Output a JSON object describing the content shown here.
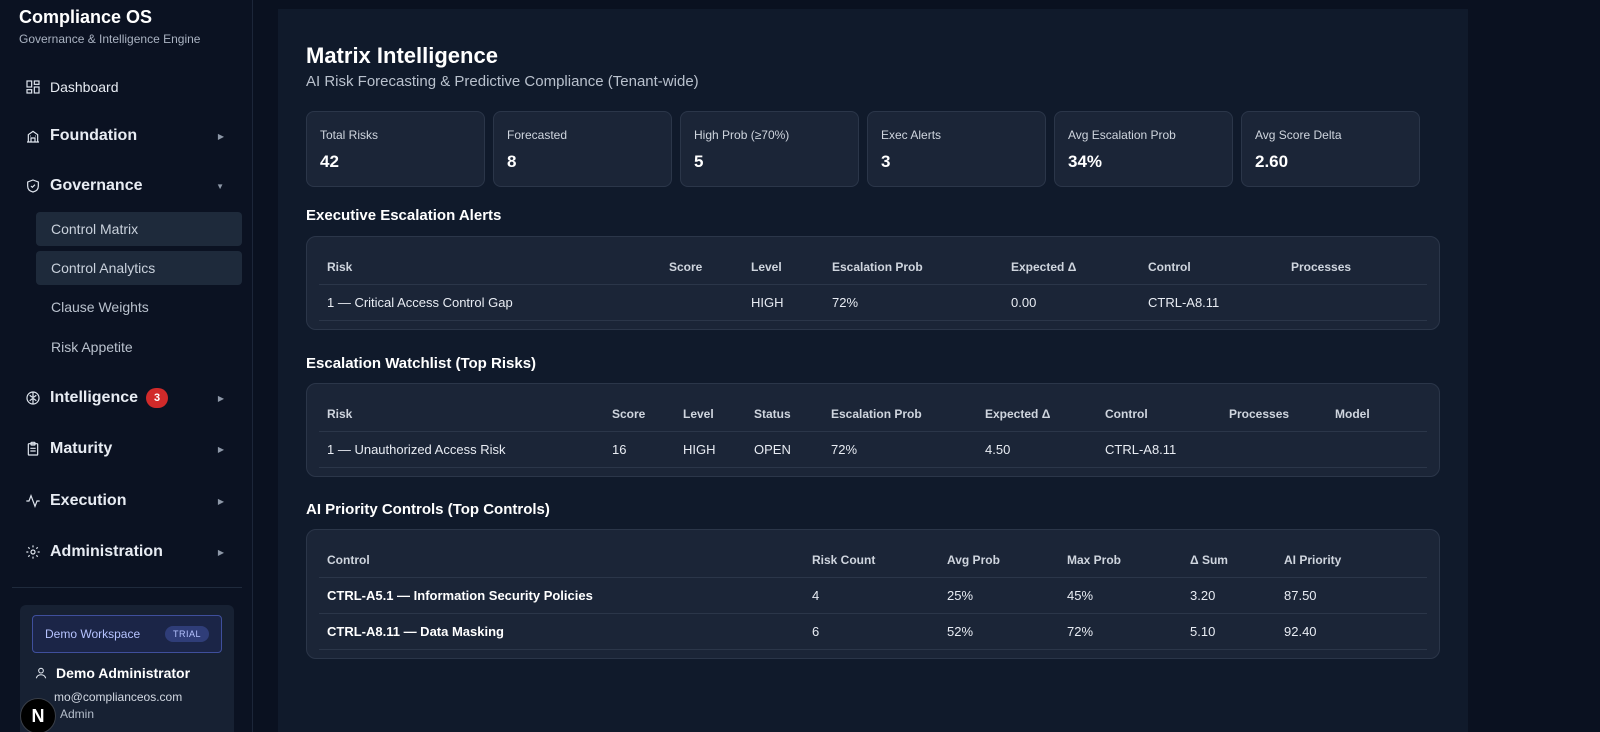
{
  "app": {
    "title": "Compliance OS",
    "subtitle": "Governance & Intelligence Engine"
  },
  "sidebar": {
    "dashboard": "Dashboard",
    "sections": [
      {
        "label": "Foundation"
      },
      {
        "label": "Governance"
      },
      {
        "label": "Intelligence",
        "badge": "3"
      },
      {
        "label": "Maturity"
      },
      {
        "label": "Execution"
      },
      {
        "label": "Administration"
      }
    ],
    "governance_items": [
      "Control Matrix",
      "Control Analytics",
      "Clause Weights",
      "Risk Appetite"
    ]
  },
  "user": {
    "workspace": "Demo Workspace",
    "plan": "TRIAL",
    "name": "Demo Administrator",
    "email": "mo@complianceos.com",
    "role": "Admin"
  },
  "page": {
    "title": "Matrix Intelligence",
    "subtitle": "AI Risk Forecasting & Predictive Compliance (Tenant-wide)"
  },
  "stats": [
    {
      "label": "Total Risks",
      "value": "42"
    },
    {
      "label": "Forecasted",
      "value": "8"
    },
    {
      "label": "High Prob (≥70%)",
      "value": "5"
    },
    {
      "label": "Exec Alerts",
      "value": "3"
    },
    {
      "label": "Avg Escalation Prob",
      "value": "34%"
    },
    {
      "label": "Avg Score Delta",
      "value": "2.60"
    }
  ],
  "exec_alerts": {
    "title": "Executive Escalation Alerts",
    "headers": [
      "Risk",
      "Score",
      "Level",
      "Escalation Prob",
      "Expected Δ",
      "Control",
      "Processes"
    ],
    "rows": [
      [
        "1 — Critical Access Control Gap",
        "",
        "HIGH",
        "72%",
        "0.00",
        "CTRL-A8.11",
        ""
      ]
    ]
  },
  "watchlist": {
    "title": "Escalation Watchlist (Top Risks)",
    "headers": [
      "Risk",
      "Score",
      "Level",
      "Status",
      "Escalation Prob",
      "Expected Δ",
      "Control",
      "Processes",
      "Model"
    ],
    "rows": [
      [
        "1 — Unauthorized Access Risk",
        "16",
        "HIGH",
        "OPEN",
        "72%",
        "4.50",
        "CTRL-A8.11",
        "",
        ""
      ]
    ]
  },
  "priority": {
    "title": "AI Priority Controls (Top Controls)",
    "headers": [
      "Control",
      "Risk Count",
      "Avg Prob",
      "Max Prob",
      "Δ Sum",
      "AI Priority"
    ],
    "rows": [
      [
        "CTRL-A5.1 — Information Security Policies",
        "4",
        "25%",
        "45%",
        "3.20",
        "87.50"
      ],
      [
        "CTRL-A8.11 — Data Masking",
        "6",
        "52%",
        "72%",
        "5.10",
        "92.40"
      ]
    ]
  }
}
